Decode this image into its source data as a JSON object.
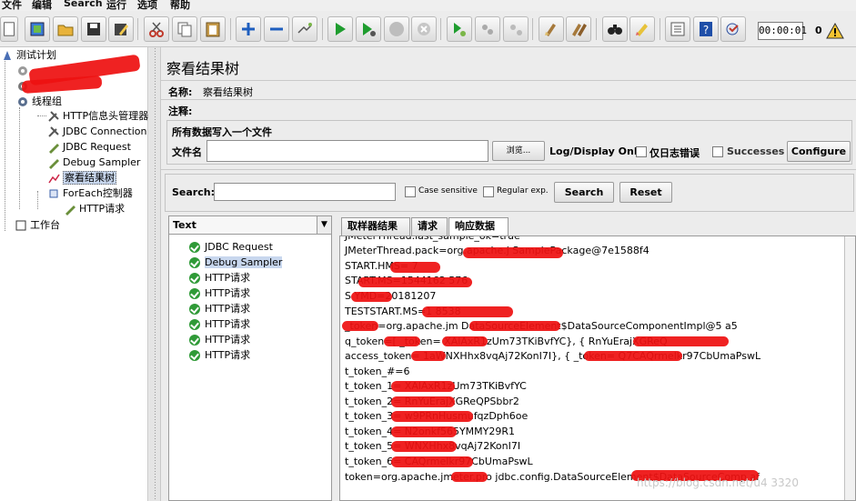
{
  "menu": [
    "文件",
    "编辑",
    "Search",
    "运行",
    "选项",
    "帮助"
  ],
  "toolbar": {
    "timer": "00:00:01",
    "error_count": "0"
  },
  "tree": {
    "root": "测试计划",
    "thread_group": "线程组",
    "items": [
      "HTTP信息头管理器",
      "JDBC Connection",
      "JDBC Request",
      "Debug Sampler",
      "察看结果树",
      "ForEach控制器"
    ],
    "foreach_child": "HTTP请求",
    "workbench": "工作台"
  },
  "panel": {
    "title": "察看结果树",
    "name_label": "名称:",
    "name_value": "察看结果树",
    "comment_label": "注释:",
    "group_title": "所有数据写入一个文件",
    "filename_label": "文件名",
    "browse": "浏览...",
    "logdisplay": "Log/Display Only:",
    "only_errors": "仅日志错误",
    "successes": "Successes",
    "configure": "Configure"
  },
  "search": {
    "label": "Search:",
    "case_sensitive": "Case sensitive",
    "regular_exp": "Regular exp.",
    "search_btn": "Search",
    "reset_btn": "Reset"
  },
  "results": {
    "combo": "Text",
    "items": [
      "JDBC Request",
      "Debug Sampler",
      "HTTP请求",
      "HTTP请求",
      "HTTP请求",
      "HTTP请求",
      "HTTP请求",
      "HTTP请求"
    ]
  },
  "tabs": [
    "取样器结果",
    "请求",
    "响应数据"
  ],
  "response_lines": [
    "JMeterThread.last_sample_ok=true",
    "JMeterThread.pack=org.apache.j                SamplePackage@7e1588f4",
    "START.HMS=         7",
    "START.MS=1544162         576",
    "S          YMD=20181207",
    "TESTSTART.MS=1          8538",
    "          _token=org.apache.jm                      DataSourceElement$DataSourceComponentImpl@5           a5",
    "q_token=[          _token=            XAlAxR1zUm73TKiBvfYC}, {                           RnYuErajXGReQ",
    "access_token=           1aWNXHhx8vqAj72KonI7I}, {          _token=                 Q7CAQrmelkr97CbUmaPswL",
    "t_token_#=6",
    "t_token_1=             XAlAxR1zUm73TKiBvfYC",
    "t_token_2=            RnYuErajXGReQPSbbr2",
    "t_token_3=                 w9PRnHusmufqzDph6oe",
    "t_token_4=            N2onkf565YMMY29R1",
    "t_token_5=            WNXHhx8vqAj72KonI7I",
    "t_token_6=             CAQrmelkr97CbUmaPswL",
    "token=org.apache.jmeter.pro          jdbc.config.DataSourceElement$DataSourceComp              af"
  ],
  "watermark": "https://blog.csdn.net/u4        3320"
}
